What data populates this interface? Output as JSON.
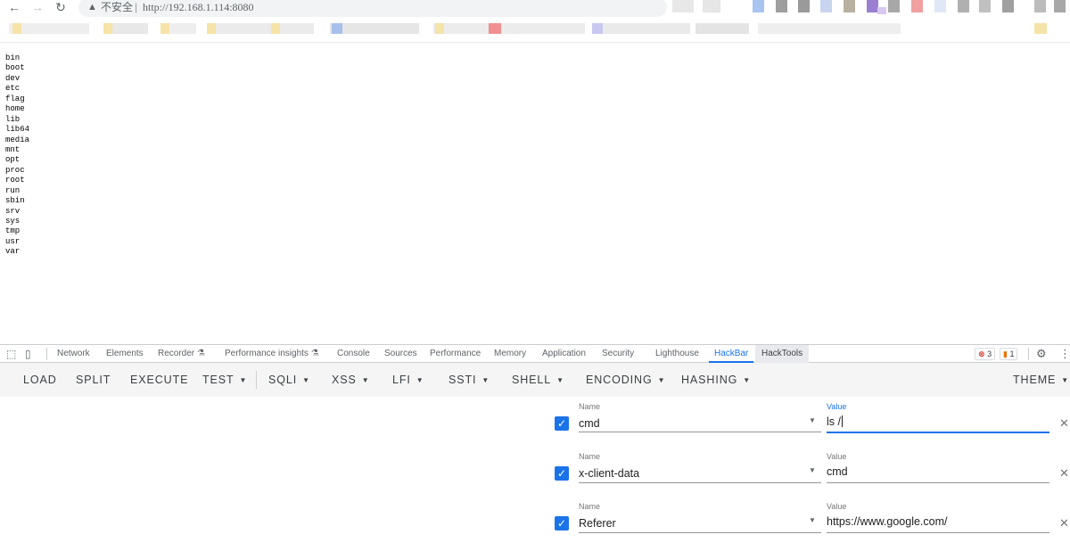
{
  "browser": {
    "back_icon": "arrow-left-icon",
    "forward_icon": "arrow-right-icon",
    "reload_icon": "reload-icon",
    "warning_icon": "warning-triangle-icon",
    "security_label": "不安全",
    "separator": "|",
    "url": "http://192.168.1.114:8080"
  },
  "page": {
    "listing": [
      "bin",
      "boot",
      "dev",
      "etc",
      "flag",
      "home",
      "lib",
      "lib64",
      "media",
      "mnt",
      "opt",
      "proc",
      "root",
      "run",
      "sbin",
      "srv",
      "sys",
      "tmp",
      "usr",
      "var"
    ]
  },
  "devtools": {
    "inspect_icon": "inspect-element-icon",
    "device_icon": "device-toolbar-icon",
    "tabs": [
      "Network",
      "Elements",
      "Recorder",
      "Performance insights",
      "Console",
      "Sources",
      "Performance",
      "Memory",
      "Application",
      "Security",
      "Lighthouse",
      "HackBar",
      "HackTools"
    ],
    "active_tab": "HackBar",
    "errors_count": "3",
    "warnings_count": "1",
    "settings_icon": "gear-icon",
    "more_icon": "kebab-menu-icon"
  },
  "hackbar": {
    "buttons": {
      "load": "LOAD",
      "split": "SPLIT",
      "execute": "EXECUTE",
      "test": "TEST",
      "sqli": "SQLI",
      "xss": "XSS",
      "lfi": "LFI",
      "ssti": "SSTI",
      "shell": "SHELL",
      "encoding": "ENCODING",
      "hashing": "HASHING",
      "theme": "THEME"
    },
    "headers": [
      {
        "name_label": "Name",
        "name": "cmd",
        "value_label": "Value",
        "value": "ls /",
        "enabled": true
      },
      {
        "name_label": "Name",
        "name": "x-client-data",
        "value_label": "Value",
        "value": "cmd",
        "enabled": true
      },
      {
        "name_label": "Name",
        "name": "Referer",
        "value_label": "Value",
        "value": "https://www.google.com/",
        "enabled": true
      }
    ]
  },
  "colors": {
    "accent": "#1a73e8",
    "error": "#d93025",
    "warning": "#e37400"
  }
}
